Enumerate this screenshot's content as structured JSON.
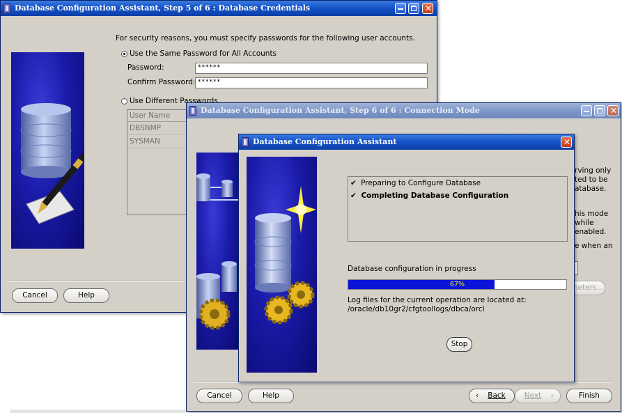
{
  "step5": {
    "title": "Database Configuration Assistant, Step 5 of 6 : Database Credentials",
    "intro": "For security reasons, you must specify passwords for the following user accounts.",
    "same_password_label": "Use the Same Password for All Accounts",
    "password_label": "Password:",
    "password_value": "******",
    "confirm_label": "Confirm Password:",
    "confirm_value": "******",
    "different_passwords_label": "Use Different Passwords",
    "table_header": "User Name",
    "users": [
      "DBSNMP",
      "SYSMAN"
    ],
    "cancel": "Cancel",
    "help": "Help"
  },
  "step6": {
    "title": "Database Configuration Assistant, Step 6 of 6 : Connection Mode",
    "partial_text": [
      "rving only",
      "ted to be",
      "atabase.",
      "his mode",
      "while",
      "enabled.",
      "e when an"
    ],
    "params_button": "meters...",
    "cancel": "Cancel",
    "help": "Help",
    "back": "Back",
    "next": "Next",
    "finish": "Finish"
  },
  "progress": {
    "title": "Database Configuration Assistant",
    "steps": [
      {
        "label": "Preparing to Configure Database",
        "bold": false
      },
      {
        "label": "Completing Database Configuration",
        "bold": true
      }
    ],
    "check_mark": "✔",
    "status_label": "Database configuration in progress",
    "percent": 67,
    "percent_label": "67%",
    "log_line1": "Log files for the current operation are located at:",
    "log_line2": "/oracle/db10gr2/cfgtoollogs/dbca/orcl",
    "stop": "Stop"
  },
  "colors": {
    "titlebar_active": "#1654c8",
    "progress_fill": "#0a14d8",
    "art_blue": "#1a1aa8"
  }
}
